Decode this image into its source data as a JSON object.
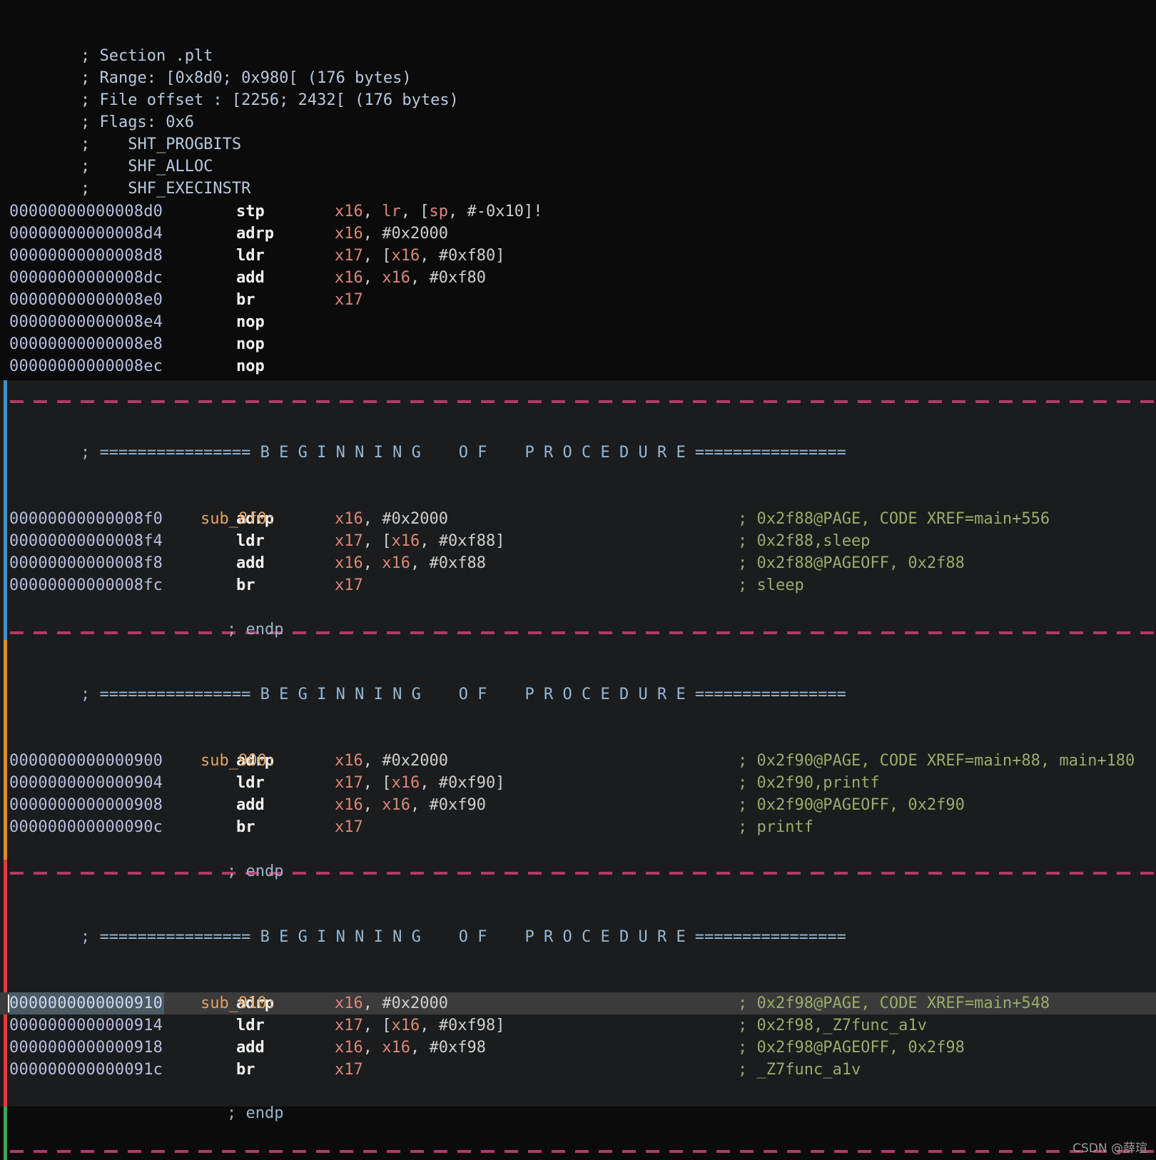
{
  "meta": {
    "watermark": "CSDN @薛瑄"
  },
  "section_header": {
    "lines": [
      "; Section .plt",
      "; Range: [0x8d0; 0x980[ (176 bytes)",
      "; File offset : [2256; 2432[ (176 bytes)",
      "; Flags: 0x6",
      ";    SHT_PROGBITS",
      ";    SHF_ALLOC",
      ";    SHF_EXECINSTR"
    ]
  },
  "procedure_banner": "; ================ B E G I N N I N G    O F    P R O C E D U R E ================",
  "endp_text": "; endp",
  "blocks": [
    {
      "id": "plt-stub-0",
      "gutter_color": "none",
      "label": null,
      "instructions": [
        {
          "addr": "00000000000008d0",
          "mnemonic": "stp",
          "operands": [
            {
              "t": "reg",
              "v": "x16"
            },
            {
              "t": "p",
              "v": ", "
            },
            {
              "t": "reg",
              "v": "lr"
            },
            {
              "t": "p",
              "v": ", ["
            },
            {
              "t": "reg",
              "v": "sp"
            },
            {
              "t": "p",
              "v": ", #-0x10]!"
            }
          ],
          "comment": ""
        },
        {
          "addr": "00000000000008d4",
          "mnemonic": "adrp",
          "operands": [
            {
              "t": "reg",
              "v": "x16"
            },
            {
              "t": "p",
              "v": ", #0x2000"
            }
          ],
          "comment": ""
        },
        {
          "addr": "00000000000008d8",
          "mnemonic": "ldr",
          "operands": [
            {
              "t": "reg",
              "v": "x17"
            },
            {
              "t": "p",
              "v": ", ["
            },
            {
              "t": "reg",
              "v": "x16"
            },
            {
              "t": "p",
              "v": ", #0xf80]"
            }
          ],
          "comment": ""
        },
        {
          "addr": "00000000000008dc",
          "mnemonic": "add",
          "operands": [
            {
              "t": "reg",
              "v": "x16"
            },
            {
              "t": "p",
              "v": ", "
            },
            {
              "t": "reg",
              "v": "x16"
            },
            {
              "t": "p",
              "v": ", #0xf80"
            }
          ],
          "comment": ""
        },
        {
          "addr": "00000000000008e0",
          "mnemonic": "br",
          "operands": [
            {
              "t": "reg",
              "v": "x17"
            }
          ],
          "comment": ""
        },
        {
          "addr": "00000000000008e4",
          "mnemonic": "nop",
          "operands": [],
          "comment": ""
        },
        {
          "addr": "00000000000008e8",
          "mnemonic": "nop",
          "operands": [],
          "comment": ""
        },
        {
          "addr": "00000000000008ec",
          "mnemonic": "nop",
          "operands": [],
          "comment": ""
        }
      ]
    },
    {
      "id": "sub_8f0",
      "gutter_color": "blue",
      "label": "sub_8f0:",
      "instructions": [
        {
          "addr": "00000000000008f0",
          "mnemonic": "adrp",
          "operands": [
            {
              "t": "reg",
              "v": "x16"
            },
            {
              "t": "p",
              "v": ", #0x2000"
            }
          ],
          "comment": "; 0x2f88@PAGE, CODE XREF=main+556"
        },
        {
          "addr": "00000000000008f4",
          "mnemonic": "ldr",
          "operands": [
            {
              "t": "reg",
              "v": "x17"
            },
            {
              "t": "p",
              "v": ", ["
            },
            {
              "t": "reg",
              "v": "x16"
            },
            {
              "t": "p",
              "v": ", #0xf88]"
            }
          ],
          "comment": "; 0x2f88,sleep"
        },
        {
          "addr": "00000000000008f8",
          "mnemonic": "add",
          "operands": [
            {
              "t": "reg",
              "v": "x16"
            },
            {
              "t": "p",
              "v": ", "
            },
            {
              "t": "reg",
              "v": "x16"
            },
            {
              "t": "p",
              "v": ", #0xf88"
            }
          ],
          "comment": "; 0x2f88@PAGEOFF, 0x2f88"
        },
        {
          "addr": "00000000000008fc",
          "mnemonic": "br",
          "operands": [
            {
              "t": "reg",
              "v": "x17"
            }
          ],
          "comment": "; sleep"
        }
      ]
    },
    {
      "id": "sub_900",
      "gutter_color": "orange",
      "label": "sub_900:",
      "instructions": [
        {
          "addr": "0000000000000900",
          "mnemonic": "adrp",
          "operands": [
            {
              "t": "reg",
              "v": "x16"
            },
            {
              "t": "p",
              "v": ", #0x2000"
            }
          ],
          "comment": "; 0x2f90@PAGE, CODE XREF=main+88, main+180"
        },
        {
          "addr": "0000000000000904",
          "mnemonic": "ldr",
          "operands": [
            {
              "t": "reg",
              "v": "x17"
            },
            {
              "t": "p",
              "v": ", ["
            },
            {
              "t": "reg",
              "v": "x16"
            },
            {
              "t": "p",
              "v": ", #0xf90]"
            }
          ],
          "comment": "; 0x2f90,printf"
        },
        {
          "addr": "0000000000000908",
          "mnemonic": "add",
          "operands": [
            {
              "t": "reg",
              "v": "x16"
            },
            {
              "t": "p",
              "v": ", "
            },
            {
              "t": "reg",
              "v": "x16"
            },
            {
              "t": "p",
              "v": ", #0xf90"
            }
          ],
          "comment": "; 0x2f90@PAGEOFF, 0x2f90"
        },
        {
          "addr": "000000000000090c",
          "mnemonic": "br",
          "operands": [
            {
              "t": "reg",
              "v": "x17"
            }
          ],
          "comment": "; printf"
        }
      ]
    },
    {
      "id": "sub_910",
      "gutter_color": "red",
      "label": "sub_910:",
      "instructions": [
        {
          "addr": "0000000000000910",
          "mnemonic": "adrp",
          "operands": [
            {
              "t": "reg",
              "v": "x16"
            },
            {
              "t": "p",
              "v": ", #0x2000"
            }
          ],
          "comment": "; 0x2f98@PAGE, CODE XREF=main+548",
          "selected": true
        },
        {
          "addr": "0000000000000914",
          "mnemonic": "ldr",
          "operands": [
            {
              "t": "reg",
              "v": "x17"
            },
            {
              "t": "p",
              "v": ", ["
            },
            {
              "t": "reg",
              "v": "x16"
            },
            {
              "t": "p",
              "v": ", #0xf98]"
            }
          ],
          "comment": "; 0x2f98,_Z7func_a1v"
        },
        {
          "addr": "0000000000000918",
          "mnemonic": "add",
          "operands": [
            {
              "t": "reg",
              "v": "x16"
            },
            {
              "t": "p",
              "v": ", "
            },
            {
              "t": "reg",
              "v": "x16"
            },
            {
              "t": "p",
              "v": ", #0xf98"
            }
          ],
          "comment": "; 0x2f98@PAGEOFF, 0x2f98"
        },
        {
          "addr": "000000000000091c",
          "mnemonic": "br",
          "operands": [
            {
              "t": "reg",
              "v": "x17"
            }
          ],
          "comment": "; _Z7func_a1v"
        }
      ]
    }
  ],
  "colors": {
    "background_dark": "#0b0b0c",
    "background_light": "#1b1c1d",
    "address": "#b8bfe0",
    "mnemonic": "#f2f2f2",
    "register": "#d98878",
    "comment": "#9aab6b",
    "label": "#e0a46a",
    "separator": "#b03a68",
    "gutter_blue": "#3e92cc",
    "gutter_orange": "#e08b21",
    "gutter_red": "#e23b3b",
    "gutter_green": "#3aa655",
    "highlight": "#3b3b3b",
    "selection": "#4a5b63"
  }
}
